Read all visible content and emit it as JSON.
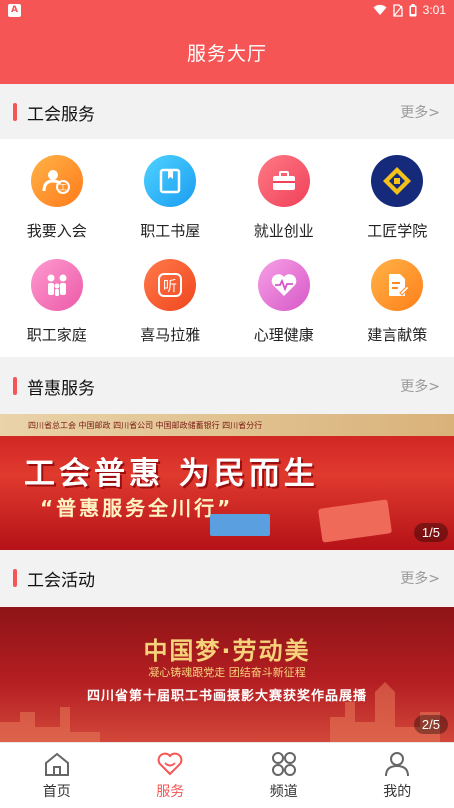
{
  "status_bar": {
    "left_badge": "A",
    "time": "3:01"
  },
  "header": {
    "title": "服务大厅"
  },
  "sections": [
    {
      "title": "工会服务",
      "more": "更多>"
    },
    {
      "title": "普惠服务",
      "more": "更多>"
    },
    {
      "title": "工会活动",
      "more": "更多>"
    }
  ],
  "services": [
    {
      "label": "我要入会",
      "icon": "union-join-icon"
    },
    {
      "label": "职工书屋",
      "icon": "bookshelf-icon"
    },
    {
      "label": "就业创业",
      "icon": "briefcase-icon"
    },
    {
      "label": "工匠学院",
      "icon": "craftsman-logo-icon"
    },
    {
      "label": "职工家庭",
      "icon": "family-icon"
    },
    {
      "label": "喜马拉雅",
      "icon": "ximalaya-icon"
    },
    {
      "label": "心理健康",
      "icon": "heart-pulse-icon"
    },
    {
      "label": "建言献策",
      "icon": "document-edit-icon"
    }
  ],
  "banners": [
    {
      "top_line": "四川省总工会   中国邮政   四川省公司   中国邮政储蓄银行   四川省分行",
      "headline": "工会普惠  为民而生",
      "subline": "“普惠服务全川行”",
      "pager": "1/5"
    },
    {
      "headline": "中国梦·劳动美",
      "subline": "凝心铸魂跟党走  团结奋斗新征程",
      "caption": "四川省第十届职工书画摄影大赛获奖作品展播",
      "pager": "2/5"
    }
  ],
  "bottom_nav": [
    {
      "label": "首页",
      "icon": "home-icon",
      "active": false
    },
    {
      "label": "服务",
      "icon": "heart-icon",
      "active": true
    },
    {
      "label": "频道",
      "icon": "grid-icon",
      "active": false
    },
    {
      "label": "我的",
      "icon": "user-icon",
      "active": false
    }
  ],
  "colors": {
    "accent": "#f55555",
    "more_text": "#9a9a9a"
  }
}
